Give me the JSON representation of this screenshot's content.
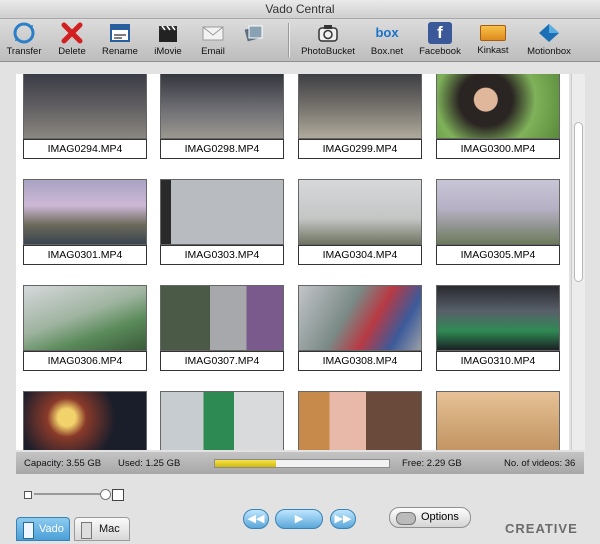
{
  "window": {
    "title": "Vado Central"
  },
  "toolbar": {
    "transfer": "Transfer",
    "delete": "Delete",
    "rename": "Rename",
    "imovie": "iMovie",
    "email": "Email",
    "photobucket": "PhotoBucket",
    "boxnet": "Box.net",
    "facebook": "Facebook",
    "kinkast": "Kinkast",
    "motionbox": "Motionbox"
  },
  "videos": [
    "IMAG0294.MP4",
    "IMAG0298.MP4",
    "IMAG0299.MP4",
    "IMAG0300.MP4",
    "IMAG0301.MP4",
    "IMAG0303.MP4",
    "IMAG0304.MP4",
    "IMAG0305.MP4",
    "IMAG0306.MP4",
    "IMAG0307.MP4",
    "IMAG0308.MP4",
    "IMAG0310.MP4"
  ],
  "status": {
    "capacity": "Capacity: 3.55 GB",
    "used": "Used: 1.25 GB",
    "free": "Free: 2.29 GB",
    "videos": "No. of videos: 36",
    "used_fraction": 0.35
  },
  "devices": {
    "vado": "Vado",
    "mac": "Mac"
  },
  "options_label": "Options",
  "brand": "CREATIVE",
  "colors": {
    "accent": "#4a9fd8",
    "facebook": "#3b5998",
    "used_bar": "#e6cf2a"
  }
}
